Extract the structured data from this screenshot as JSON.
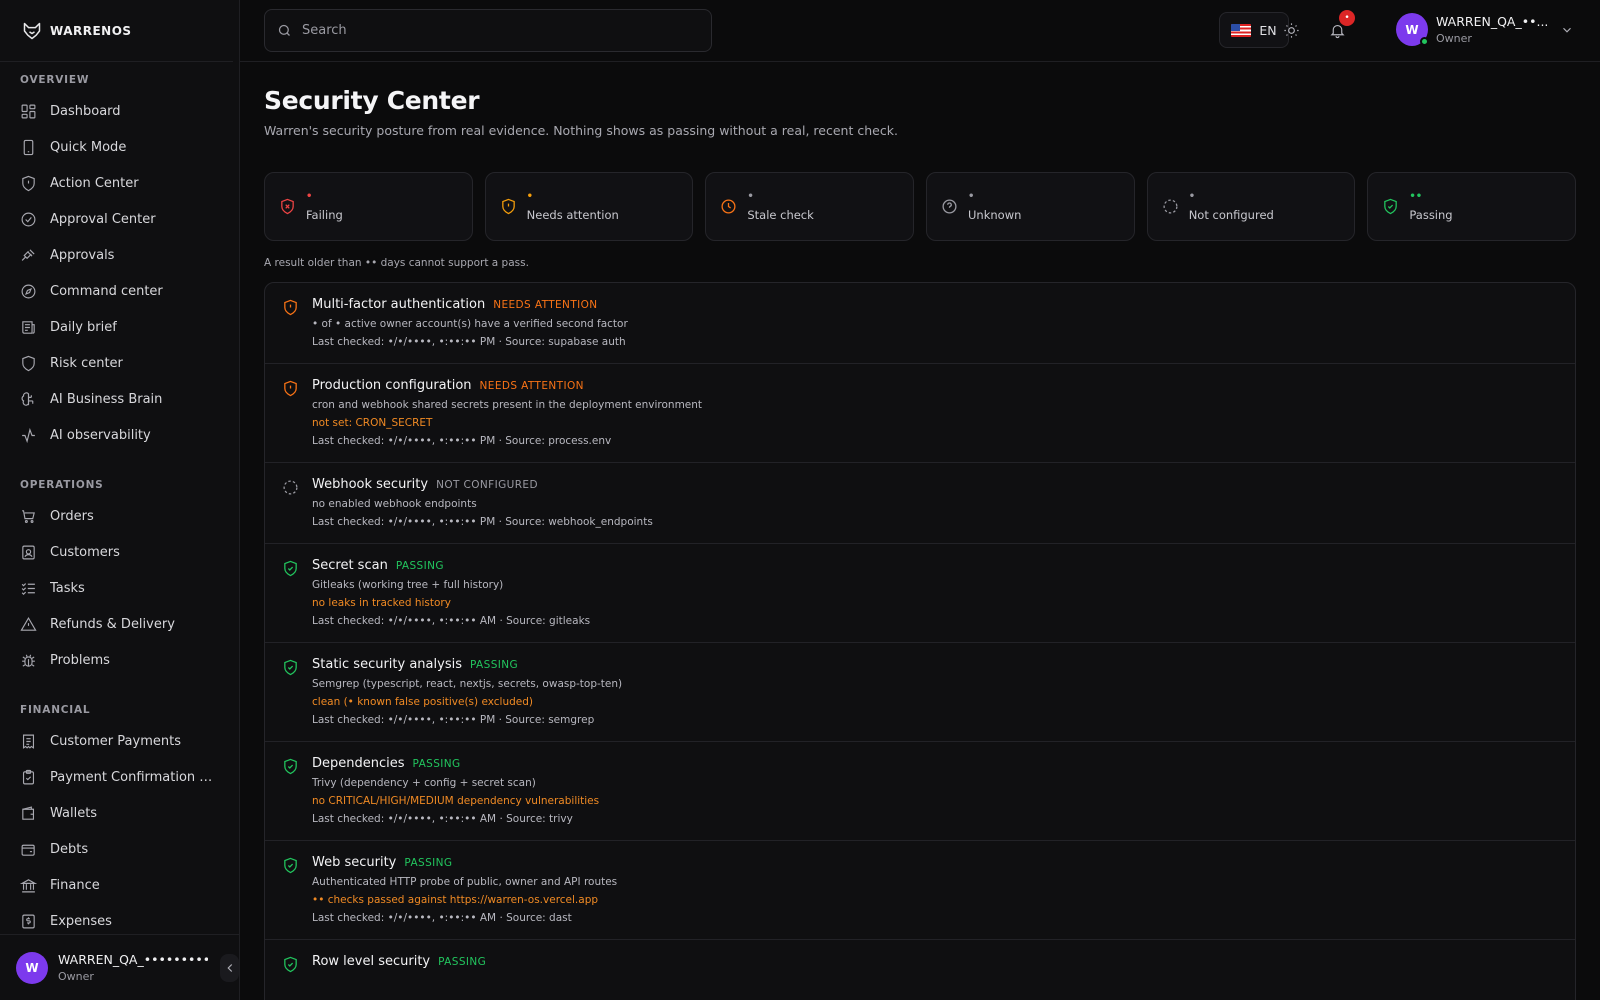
{
  "brand": {
    "name": "WARRENOS"
  },
  "search": {
    "placeholder": "Search"
  },
  "header": {
    "language": "EN",
    "notification_count": "•",
    "user": {
      "initial": "W",
      "name": "WARREN_QA_••...",
      "role": "Owner"
    }
  },
  "sidebar": {
    "sections": [
      {
        "title": "OVERVIEW",
        "items": [
          {
            "label": "Dashboard",
            "icon": "layout-grid-icon"
          },
          {
            "label": "Quick Mode",
            "icon": "smartphone-icon"
          },
          {
            "label": "Action Center",
            "icon": "shield-icon"
          },
          {
            "label": "Approval Center",
            "icon": "check-circle-icon"
          },
          {
            "label": "Approvals",
            "icon": "gavel-icon"
          },
          {
            "label": "Command center",
            "icon": "compass-icon"
          },
          {
            "label": "Daily brief",
            "icon": "newspaper-icon"
          },
          {
            "label": "Risk center",
            "icon": "shield-alert-icon"
          },
          {
            "label": "AI Business Brain",
            "icon": "brain-icon"
          },
          {
            "label": "AI observability",
            "icon": "activity-icon"
          }
        ]
      },
      {
        "title": "OPERATIONS",
        "items": [
          {
            "label": "Orders",
            "icon": "cart-icon"
          },
          {
            "label": "Customers",
            "icon": "contact-icon"
          },
          {
            "label": "Tasks",
            "icon": "list-checks-icon"
          },
          {
            "label": "Refunds & Delivery",
            "icon": "alert-triangle-icon"
          },
          {
            "label": "Problems",
            "icon": "bug-icon"
          }
        ]
      },
      {
        "title": "FINANCIAL",
        "items": [
          {
            "label": "Customer Payments",
            "icon": "receipt-icon"
          },
          {
            "label": "Payment Confirmation Re...",
            "icon": "clipboard-check-icon"
          },
          {
            "label": "Wallets",
            "icon": "wallet-icon"
          },
          {
            "label": "Debts",
            "icon": "wallet-minus-icon"
          },
          {
            "label": "Finance",
            "icon": "landmark-icon"
          },
          {
            "label": "Expenses",
            "icon": "dollar-receipt-icon"
          }
        ]
      }
    ],
    "footer": {
      "initial": "W",
      "name": "WARREN_QA_•••••••••",
      "role": "Owner"
    }
  },
  "page": {
    "title": "Security Center",
    "subtitle": "Warren's security posture from real evidence. Nothing shows as passing without a real, recent check.",
    "note": "A result older than •• days cannot support a pass."
  },
  "stats": [
    {
      "value": "•",
      "label": "Failing",
      "icon": "shield-x-icon",
      "color": "#ef4444"
    },
    {
      "value": "•",
      "label": "Needs attention",
      "icon": "shield-alert-icon",
      "color": "#f59e0b"
    },
    {
      "value": "•",
      "label": "Stale check",
      "icon": "clock-icon",
      "color": "#f97316"
    },
    {
      "value": "•",
      "label": "Unknown",
      "icon": "help-circle-icon",
      "color": "#9a9aa2"
    },
    {
      "value": "•",
      "label": "Not configured",
      "icon": "dashed-circle-icon",
      "color": "#9a9aa2"
    },
    {
      "value": "••",
      "label": "Passing",
      "icon": "shield-check-icon",
      "color": "#22c55e"
    }
  ],
  "checks": [
    {
      "title": "Multi-factor authentication",
      "status": "NEEDS ATTENTION",
      "icon": "shield-alert-icon",
      "detail": "• of • active owner account(s) have a verified second factor",
      "warning": "",
      "meta": "Last checked: •/•/••••, •:••:•• PM · Source: supabase auth"
    },
    {
      "title": "Production configuration",
      "status": "NEEDS ATTENTION",
      "icon": "shield-alert-icon",
      "detail": "cron and webhook shared secrets present in the deployment environment",
      "warning": "not set: CRON_SECRET",
      "meta": "Last checked: •/•/••••, •:••:•• PM · Source: process.env"
    },
    {
      "title": "Webhook security",
      "status": "NOT CONFIGURED",
      "icon": "dashed-circle-icon",
      "detail": "no enabled webhook endpoints",
      "warning": "",
      "meta": "Last checked: •/•/••••, •:••:•• PM · Source: webhook_endpoints"
    },
    {
      "title": "Secret scan",
      "status": "PASSING",
      "icon": "shield-check-icon",
      "detail": "Gitleaks (working tree + full history)",
      "warning": "no leaks in tracked history",
      "meta": "Last checked: •/•/••••, •:••:•• AM · Source: gitleaks"
    },
    {
      "title": "Static security analysis",
      "status": "PASSING",
      "icon": "shield-check-icon",
      "detail": "Semgrep (typescript, react, nextjs, secrets, owasp-top-ten)",
      "warning": "clean (• known false positive(s) excluded)",
      "meta": "Last checked: •/•/••••, •:••:•• PM · Source: semgrep"
    },
    {
      "title": "Dependencies",
      "status": "PASSING",
      "icon": "shield-check-icon",
      "detail": "Trivy (dependency + config + secret scan)",
      "warning": "no CRITICAL/HIGH/MEDIUM dependency vulnerabilities",
      "meta": "Last checked: •/•/••••, •:••:•• AM · Source: trivy"
    },
    {
      "title": "Web security",
      "status": "PASSING",
      "icon": "shield-check-icon",
      "detail": "Authenticated HTTP probe of public, owner and API routes",
      "warning": "•• checks passed against https://warren-os.vercel.app",
      "meta": "Last checked: •/•/••••, •:••:•• AM · Source: dast"
    },
    {
      "title": "Row level security",
      "status": "PASSING",
      "icon": "shield-check-icon",
      "detail": "",
      "warning": "",
      "meta": ""
    }
  ]
}
